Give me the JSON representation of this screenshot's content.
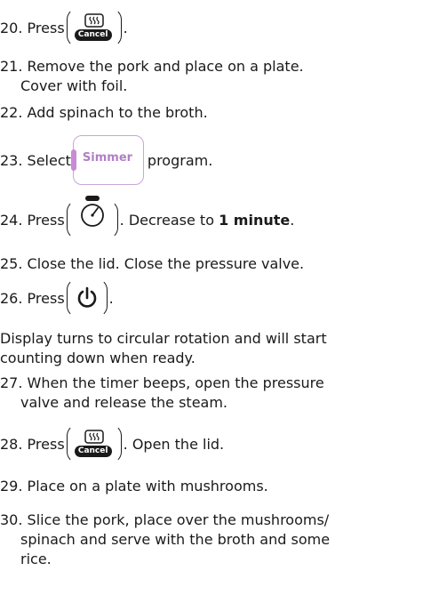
{
  "steps": {
    "s20": {
      "num": "20.",
      "pre": "Press",
      "post": ".",
      "btn_label": "Cancel"
    },
    "s21": {
      "num": "21.",
      "line1": "Remove the pork and place on a plate.",
      "line2": "Cover with foil."
    },
    "s22": {
      "num": "22.",
      "text": "Add spinach to the broth."
    },
    "s23": {
      "num": "23.",
      "pre": "Select",
      "btn_label": "Simmer",
      "post": "program."
    },
    "s24": {
      "num": "24.",
      "pre": "Press",
      "post": ". Decrease to",
      "bold": "1 minute",
      "end": "."
    },
    "s25": {
      "num": "25.",
      "text": "Close the lid. Close the pressure valve."
    },
    "s26": {
      "num": "26.",
      "pre": "Press",
      "post": "."
    },
    "note": {
      "line1": "Display turns to circular rotation and will start",
      "line2": "counting down when ready."
    },
    "s27": {
      "num": "27.",
      "line1": "When the timer beeps, open the pressure",
      "line2": "valve and release the steam."
    },
    "s28": {
      "num": "28.",
      "pre": "Press",
      "post": ". Open the lid.",
      "btn_label": "Cancel"
    },
    "s29": {
      "num": "29.",
      "text": "Place on a plate with mushrooms."
    },
    "s30": {
      "num": "30.",
      "line1": "Slice the pork, place over the mushrooms/",
      "line2": "spinach and serve with the broth and some",
      "line3": "rice."
    }
  },
  "icons": {
    "cancel": "steam-cancel-icon",
    "timer": "stopwatch-icon",
    "power": "power-icon",
    "simmer_accent": "#c98ad6"
  }
}
